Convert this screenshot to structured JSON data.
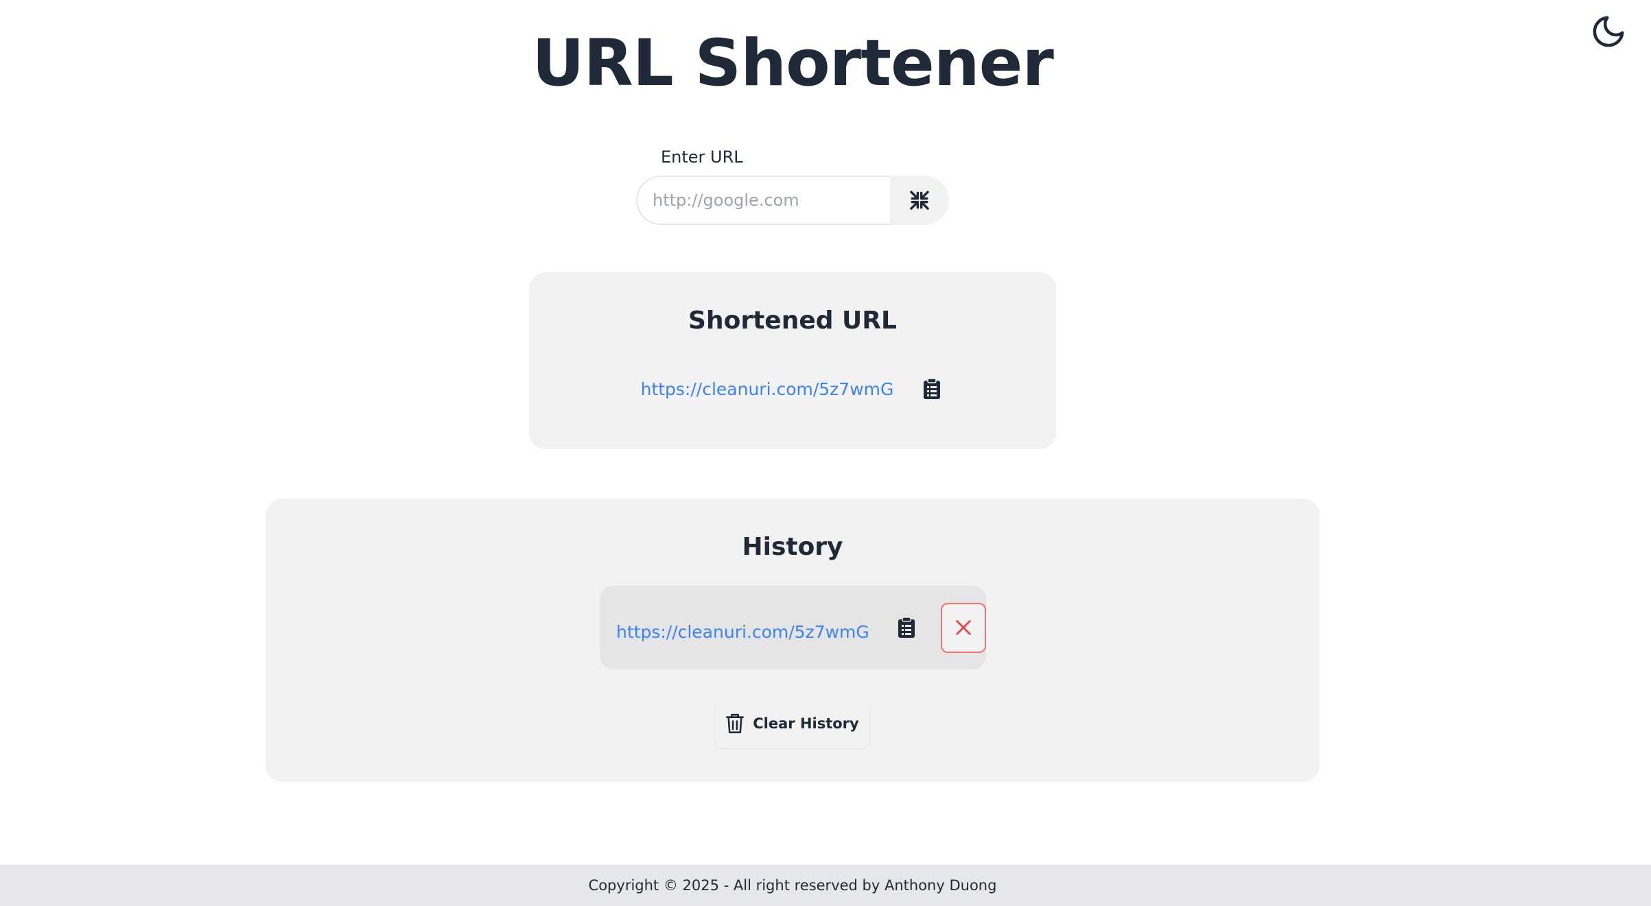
{
  "header": {
    "title": "URL Shortener",
    "theme_toggle_icon": "moon-icon"
  },
  "form": {
    "label": "Enter URL",
    "input_value": "",
    "input_placeholder": "http://google.com",
    "submit_icon": "compress-icon"
  },
  "shortened": {
    "title": "Shortened URL",
    "url": "https://cleanuri.com/5z7wmG",
    "copy_icon": "clipboard-icon"
  },
  "history": {
    "title": "History",
    "items": [
      {
        "url": "https://cleanuri.com/5z7wmG",
        "copy_icon": "clipboard-icon",
        "delete_icon": "close-icon"
      }
    ],
    "clear_label": "Clear History",
    "clear_icon": "trash-icon"
  },
  "footer": {
    "text": "Copyright © 2025 - All right reserved by Anthony Duong"
  },
  "colors": {
    "text": "#1f2937",
    "link": "#3b82f6",
    "card_bg": "#f2f2f2",
    "item_bg": "#e5e5e5",
    "danger": "#f87171",
    "footer_bg": "#e5e7eb"
  }
}
